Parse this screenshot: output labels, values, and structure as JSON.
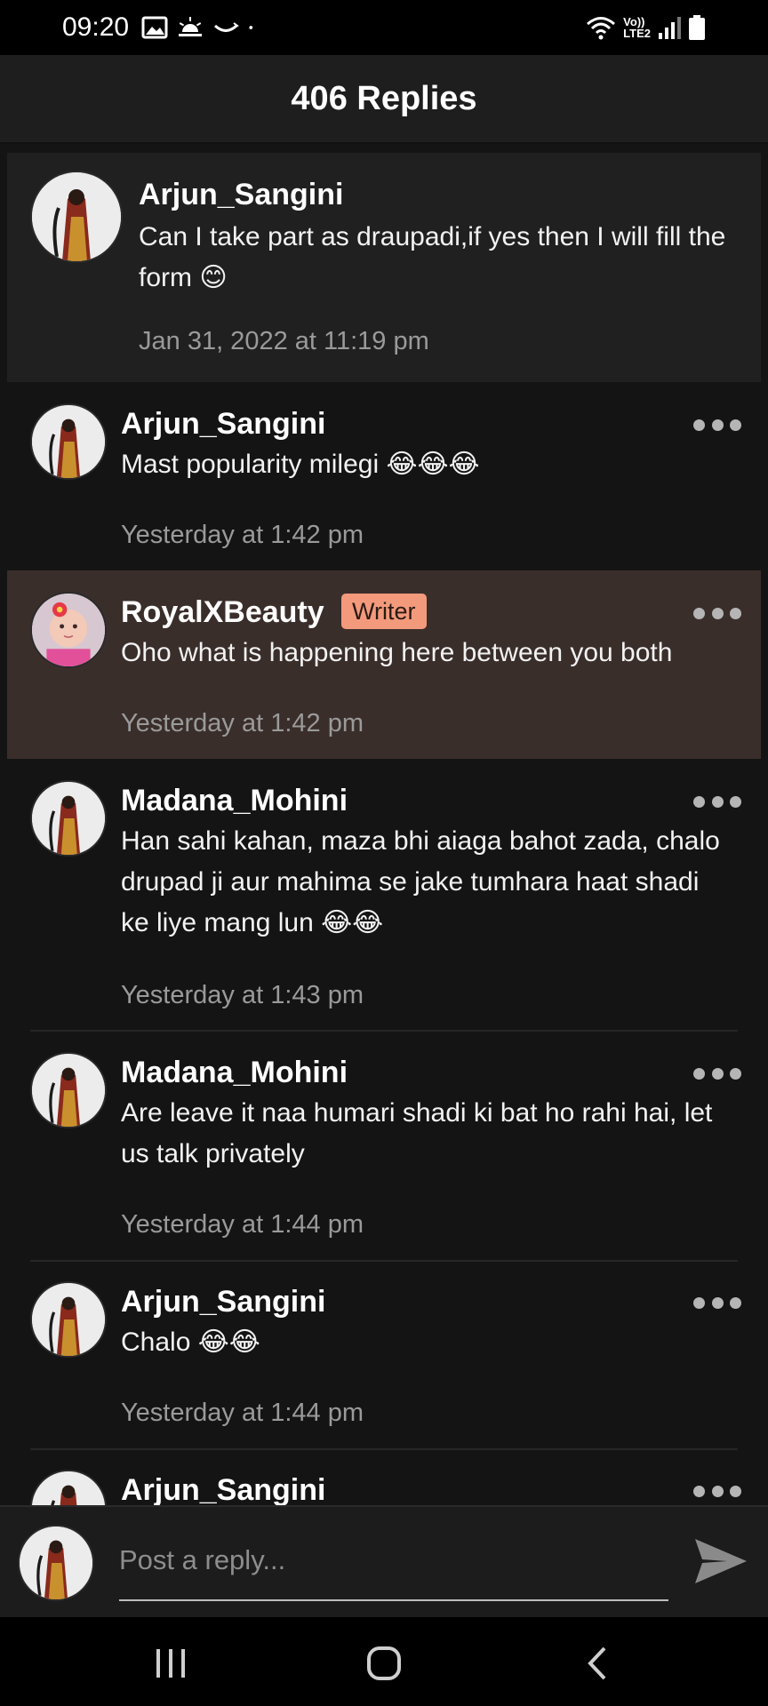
{
  "status_bar": {
    "time": "09:20",
    "left_icons": [
      "image-icon",
      "sunrise-icon",
      "smile-icon",
      "dot-icon"
    ],
    "network_label_top": "Vo))",
    "network_label_bottom": "LTE2",
    "right_icons": [
      "wifi-icon",
      "signal-icon",
      "battery-icon"
    ]
  },
  "header": {
    "title": "406 Replies"
  },
  "parent_comment": {
    "author": "Arjun_Sangini",
    "text": "Can I take part as draupadi,if yes then I will fill the form 😊",
    "time": "Jan 31, 2022 at 11:19 pm"
  },
  "replies": [
    {
      "author": "Arjun_Sangini",
      "text": "Mast popularity milegi 😂😂😂",
      "time": "Yesterday at 1:42 pm"
    },
    {
      "author": "RoyalXBeauty",
      "badge": "Writer",
      "text": "Oho what is happening here between you both",
      "time": "Yesterday at 1:42 pm"
    },
    {
      "author": "Madana_Mohini",
      "text": "Han sahi kahan, maza bhi aiaga bahot zada, chalo drupad ji aur mahima se jake tumhara haat shadi ke liye mang lun 😂😂",
      "time": "Yesterday at 1:43 pm"
    },
    {
      "author": "Madana_Mohini",
      "text": "Are leave it naa humari shadi ki bat ho rahi hai, let us talk privately",
      "time": "Yesterday at 1:44 pm"
    },
    {
      "author": "Arjun_Sangini",
      "text": "Chalo 😂😂",
      "time": "Yesterday at 1:44 pm"
    },
    {
      "author": "Arjun_Sangini"
    }
  ],
  "reply_bar": {
    "placeholder": "Post a reply..."
  },
  "nav": {
    "buttons": [
      "recent-apps-icon",
      "home-icon",
      "back-icon"
    ]
  },
  "colors": {
    "background": "#141414",
    "highlight": "#3a2e2b",
    "badge": "#f39a7c",
    "secondary_text": "#9a9a9a"
  }
}
